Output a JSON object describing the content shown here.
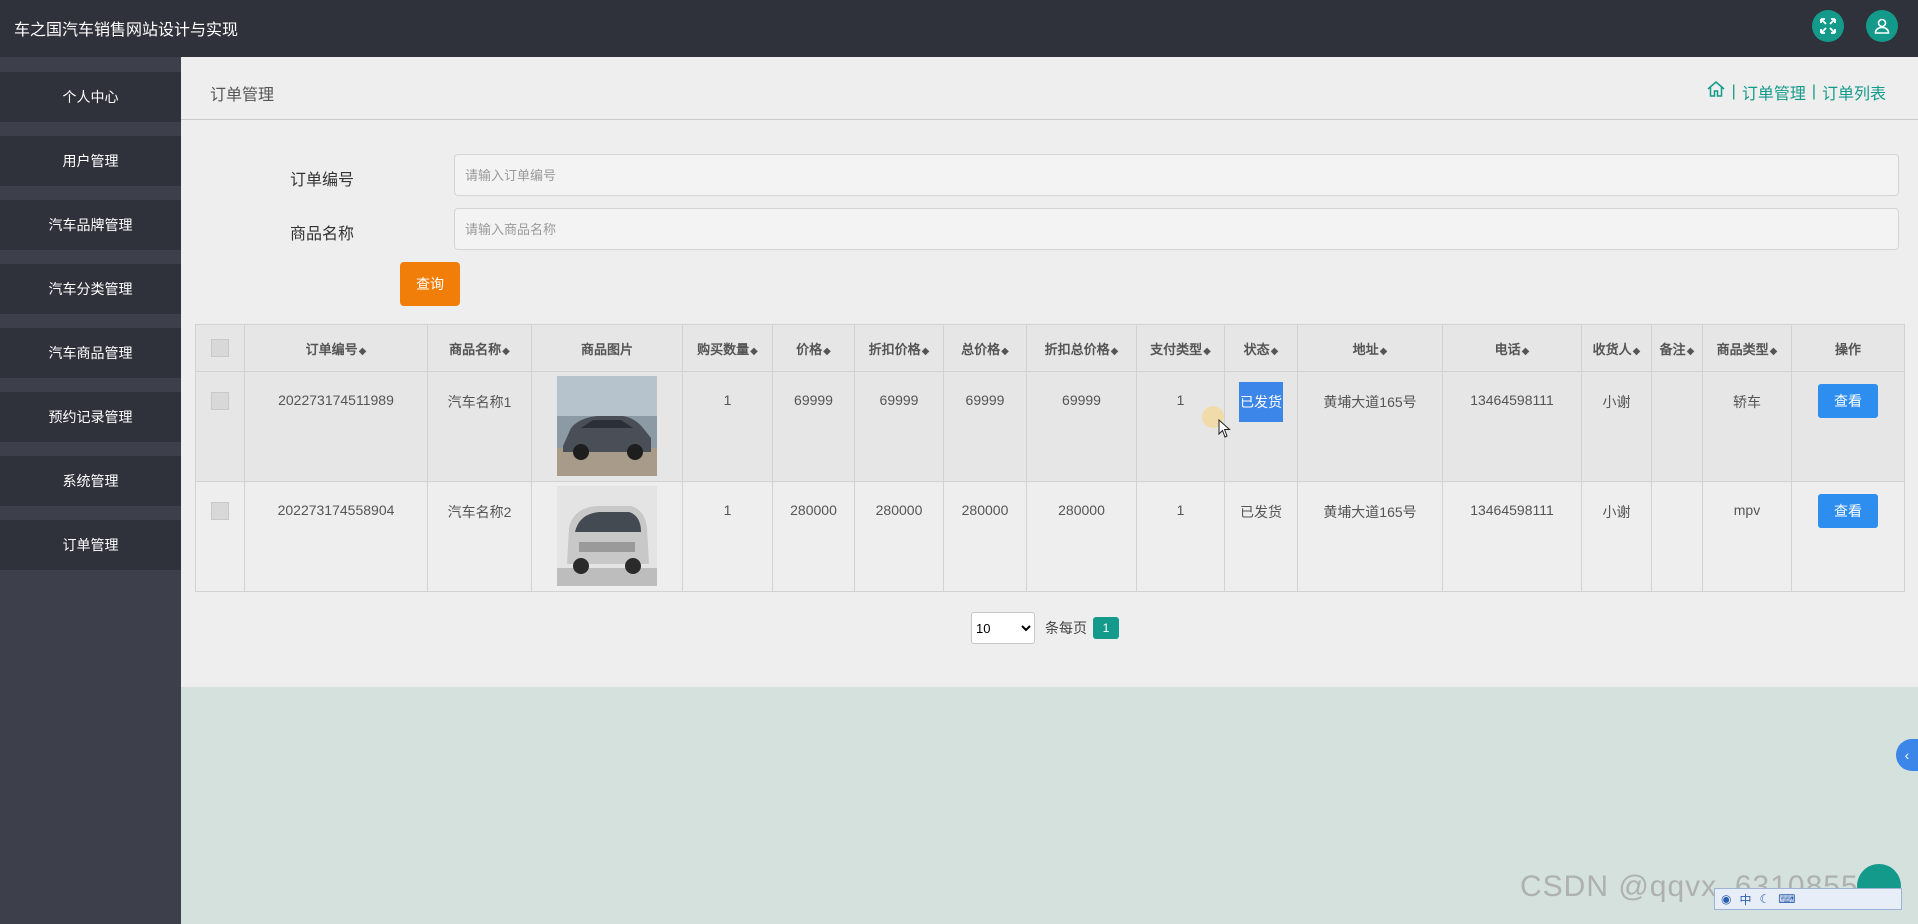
{
  "app": {
    "title": "车之国汽车销售网站设计与实现"
  },
  "colors": {
    "accent": "#149a8a",
    "primary_button": "#2d8ef0",
    "query_button": "#f27e0a",
    "sidebar": "#2f323a"
  },
  "topbar": {
    "icons": [
      "fullscreen-icon",
      "user-icon"
    ]
  },
  "sidebar": {
    "items": [
      {
        "label": "个人中心"
      },
      {
        "label": "用户管理"
      },
      {
        "label": "汽车品牌管理"
      },
      {
        "label": "汽车分类管理"
      },
      {
        "label": "汽车商品管理"
      },
      {
        "label": "预约记录管理"
      },
      {
        "label": "系统管理"
      },
      {
        "label": "订单管理"
      }
    ]
  },
  "header": {
    "title": "订单管理",
    "breadcrumb": [
      "订单管理",
      "订单列表"
    ]
  },
  "search": {
    "order_label": "订单编号",
    "order_placeholder": "请输入订单编号",
    "product_label": "商品名称",
    "product_placeholder": "请输入商品名称",
    "query_button": "查询"
  },
  "table": {
    "columns": [
      "订单编号",
      "商品名称",
      "商品图片",
      "购买数量",
      "价格",
      "折扣价格",
      "总价格",
      "折扣总价格",
      "支付类型",
      "状态",
      "地址",
      "电话",
      "收货人",
      "备注",
      "商品类型",
      "操作"
    ],
    "rows": [
      {
        "order_no": "202273174511989",
        "name": "汽车名称1",
        "qty": "1",
        "price": "69999",
        "discount_price": "69999",
        "total": "69999",
        "discount_total": "69999",
        "pay_type": "1",
        "status": "已发货",
        "address": "黄埔大道165号",
        "phone": "13464598111",
        "receiver": "小谢",
        "note": "",
        "type": "轿车",
        "action": "查看"
      },
      {
        "order_no": "202273174558904",
        "name": "汽车名称2",
        "qty": "1",
        "price": "280000",
        "discount_price": "280000",
        "total": "280000",
        "discount_total": "280000",
        "pay_type": "1",
        "status": "已发货",
        "address": "黄埔大道165号",
        "phone": "13464598111",
        "receiver": "小谢",
        "note": "",
        "type": "mpv",
        "action": "查看"
      }
    ]
  },
  "pager": {
    "page_size": "10",
    "per_page_label": "条每页",
    "current_page": "1"
  },
  "watermark": "CSDN @qqvx_6310855",
  "ime": {
    "label": "中"
  }
}
